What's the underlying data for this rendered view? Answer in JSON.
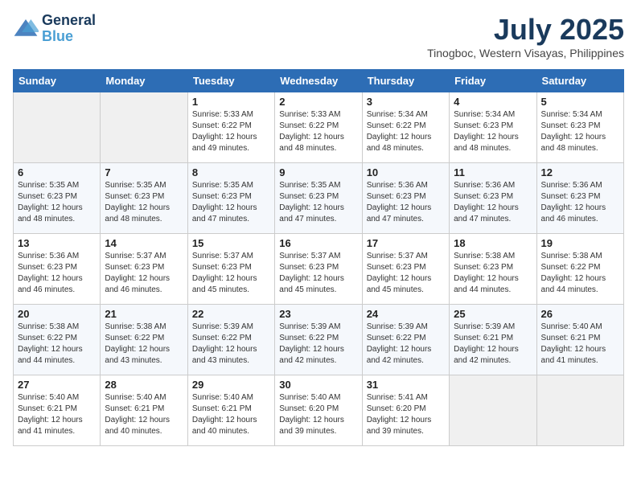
{
  "header": {
    "logo_line1": "General",
    "logo_line2": "Blue",
    "month": "July 2025",
    "location": "Tinogboc, Western Visayas, Philippines"
  },
  "weekdays": [
    "Sunday",
    "Monday",
    "Tuesday",
    "Wednesday",
    "Thursday",
    "Friday",
    "Saturday"
  ],
  "weeks": [
    [
      {
        "day": "",
        "info": ""
      },
      {
        "day": "",
        "info": ""
      },
      {
        "day": "1",
        "info": "Sunrise: 5:33 AM\nSunset: 6:22 PM\nDaylight: 12 hours\nand 49 minutes."
      },
      {
        "day": "2",
        "info": "Sunrise: 5:33 AM\nSunset: 6:22 PM\nDaylight: 12 hours\nand 48 minutes."
      },
      {
        "day": "3",
        "info": "Sunrise: 5:34 AM\nSunset: 6:22 PM\nDaylight: 12 hours\nand 48 minutes."
      },
      {
        "day": "4",
        "info": "Sunrise: 5:34 AM\nSunset: 6:23 PM\nDaylight: 12 hours\nand 48 minutes."
      },
      {
        "day": "5",
        "info": "Sunrise: 5:34 AM\nSunset: 6:23 PM\nDaylight: 12 hours\nand 48 minutes."
      }
    ],
    [
      {
        "day": "6",
        "info": "Sunrise: 5:35 AM\nSunset: 6:23 PM\nDaylight: 12 hours\nand 48 minutes."
      },
      {
        "day": "7",
        "info": "Sunrise: 5:35 AM\nSunset: 6:23 PM\nDaylight: 12 hours\nand 48 minutes."
      },
      {
        "day": "8",
        "info": "Sunrise: 5:35 AM\nSunset: 6:23 PM\nDaylight: 12 hours\nand 47 minutes."
      },
      {
        "day": "9",
        "info": "Sunrise: 5:35 AM\nSunset: 6:23 PM\nDaylight: 12 hours\nand 47 minutes."
      },
      {
        "day": "10",
        "info": "Sunrise: 5:36 AM\nSunset: 6:23 PM\nDaylight: 12 hours\nand 47 minutes."
      },
      {
        "day": "11",
        "info": "Sunrise: 5:36 AM\nSunset: 6:23 PM\nDaylight: 12 hours\nand 47 minutes."
      },
      {
        "day": "12",
        "info": "Sunrise: 5:36 AM\nSunset: 6:23 PM\nDaylight: 12 hours\nand 46 minutes."
      }
    ],
    [
      {
        "day": "13",
        "info": "Sunrise: 5:36 AM\nSunset: 6:23 PM\nDaylight: 12 hours\nand 46 minutes."
      },
      {
        "day": "14",
        "info": "Sunrise: 5:37 AM\nSunset: 6:23 PM\nDaylight: 12 hours\nand 46 minutes."
      },
      {
        "day": "15",
        "info": "Sunrise: 5:37 AM\nSunset: 6:23 PM\nDaylight: 12 hours\nand 45 minutes."
      },
      {
        "day": "16",
        "info": "Sunrise: 5:37 AM\nSunset: 6:23 PM\nDaylight: 12 hours\nand 45 minutes."
      },
      {
        "day": "17",
        "info": "Sunrise: 5:37 AM\nSunset: 6:23 PM\nDaylight: 12 hours\nand 45 minutes."
      },
      {
        "day": "18",
        "info": "Sunrise: 5:38 AM\nSunset: 6:23 PM\nDaylight: 12 hours\nand 44 minutes."
      },
      {
        "day": "19",
        "info": "Sunrise: 5:38 AM\nSunset: 6:22 PM\nDaylight: 12 hours\nand 44 minutes."
      }
    ],
    [
      {
        "day": "20",
        "info": "Sunrise: 5:38 AM\nSunset: 6:22 PM\nDaylight: 12 hours\nand 44 minutes."
      },
      {
        "day": "21",
        "info": "Sunrise: 5:38 AM\nSunset: 6:22 PM\nDaylight: 12 hours\nand 43 minutes."
      },
      {
        "day": "22",
        "info": "Sunrise: 5:39 AM\nSunset: 6:22 PM\nDaylight: 12 hours\nand 43 minutes."
      },
      {
        "day": "23",
        "info": "Sunrise: 5:39 AM\nSunset: 6:22 PM\nDaylight: 12 hours\nand 42 minutes."
      },
      {
        "day": "24",
        "info": "Sunrise: 5:39 AM\nSunset: 6:22 PM\nDaylight: 12 hours\nand 42 minutes."
      },
      {
        "day": "25",
        "info": "Sunrise: 5:39 AM\nSunset: 6:21 PM\nDaylight: 12 hours\nand 42 minutes."
      },
      {
        "day": "26",
        "info": "Sunrise: 5:40 AM\nSunset: 6:21 PM\nDaylight: 12 hours\nand 41 minutes."
      }
    ],
    [
      {
        "day": "27",
        "info": "Sunrise: 5:40 AM\nSunset: 6:21 PM\nDaylight: 12 hours\nand 41 minutes."
      },
      {
        "day": "28",
        "info": "Sunrise: 5:40 AM\nSunset: 6:21 PM\nDaylight: 12 hours\nand 40 minutes."
      },
      {
        "day": "29",
        "info": "Sunrise: 5:40 AM\nSunset: 6:21 PM\nDaylight: 12 hours\nand 40 minutes."
      },
      {
        "day": "30",
        "info": "Sunrise: 5:40 AM\nSunset: 6:20 PM\nDaylight: 12 hours\nand 39 minutes."
      },
      {
        "day": "31",
        "info": "Sunrise: 5:41 AM\nSunset: 6:20 PM\nDaylight: 12 hours\nand 39 minutes."
      },
      {
        "day": "",
        "info": ""
      },
      {
        "day": "",
        "info": ""
      }
    ]
  ]
}
